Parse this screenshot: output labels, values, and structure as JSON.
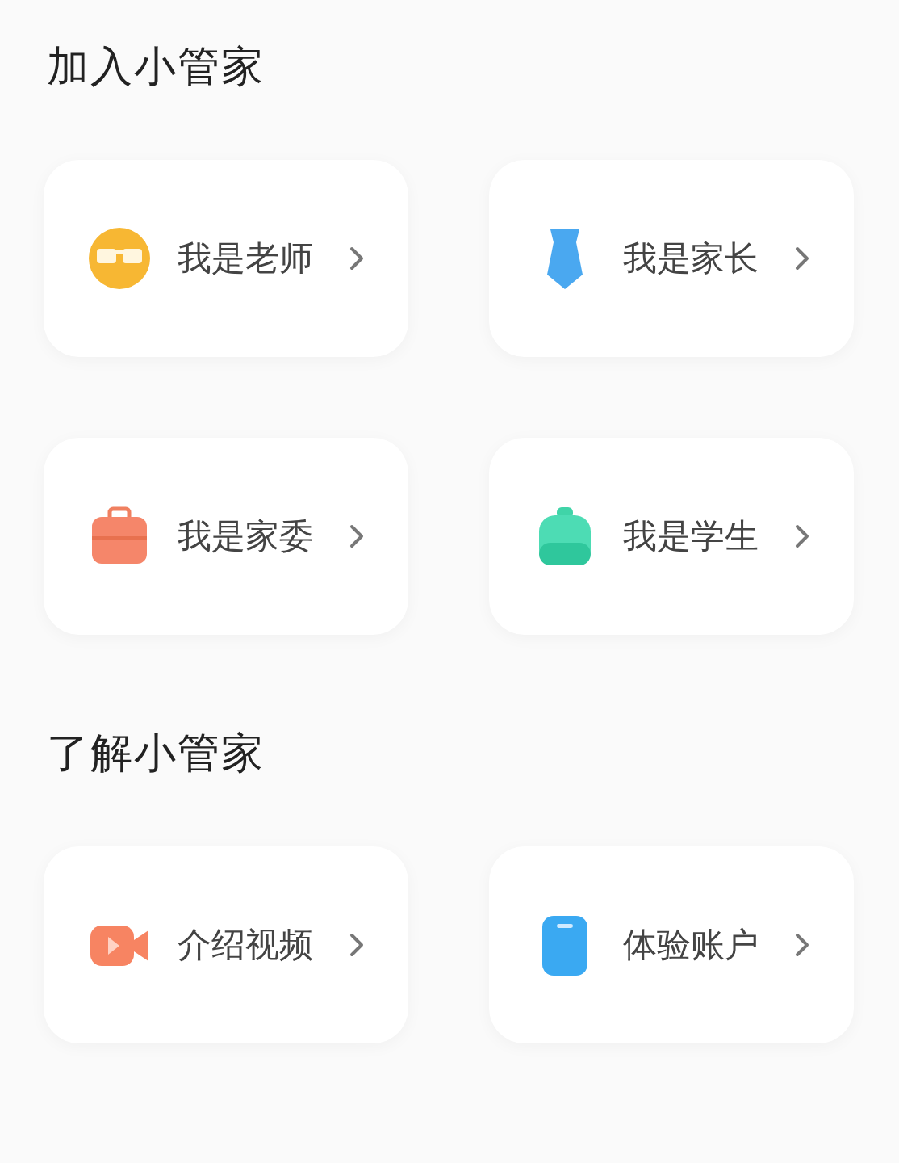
{
  "sections": [
    {
      "title": "加入小管家",
      "cards": [
        {
          "label": "我是老师",
          "kind": "glasses"
        },
        {
          "label": "我是家长",
          "kind": "tie"
        },
        {
          "label": "我是家委",
          "kind": "briefcase"
        },
        {
          "label": "我是学生",
          "kind": "bag"
        }
      ]
    },
    {
      "title": "了解小管家",
      "cards": [
        {
          "label": "介绍视频",
          "kind": "video"
        },
        {
          "label": "体验账户",
          "kind": "phone"
        }
      ]
    }
  ]
}
